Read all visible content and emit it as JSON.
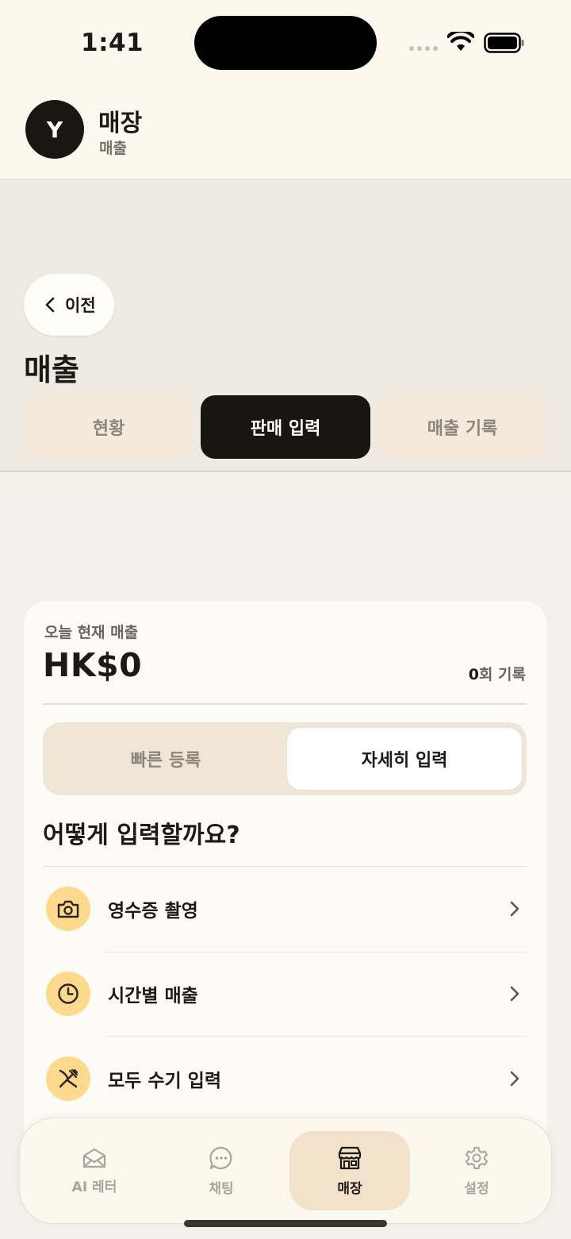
{
  "status_bar": {
    "time": "1:41"
  },
  "header": {
    "avatar_letter": "Y",
    "title": "매장",
    "subtitle": "매출"
  },
  "nav": {
    "back_label": "이전"
  },
  "page": {
    "title": "매출"
  },
  "segments": [
    {
      "label": "현황",
      "active": false
    },
    {
      "label": "판매 입력",
      "active": true
    },
    {
      "label": "매출 기록",
      "active": false
    }
  ],
  "summary": {
    "label": "오늘 현재 매출",
    "amount": "HK$0",
    "count_value": "0",
    "count_suffix": "회 기록"
  },
  "entry_mode": [
    {
      "label": "빠른 등록",
      "active": false
    },
    {
      "label": "자세히 입력",
      "active": true
    }
  ],
  "question": "어떻게 입력할까요?",
  "options": [
    {
      "label": "영수증 촬영",
      "icon": "camera-icon"
    },
    {
      "label": "시간별 매출",
      "icon": "clock-icon"
    },
    {
      "label": "모두 수기 입력",
      "icon": "utensils-icon"
    }
  ],
  "tabbar": [
    {
      "label": "AI 레터",
      "icon": "mail-icon",
      "active": false
    },
    {
      "label": "채팅",
      "icon": "chat-icon",
      "active": false
    },
    {
      "label": "매장",
      "icon": "store-icon",
      "active": true
    },
    {
      "label": "설정",
      "icon": "gear-icon",
      "active": false
    }
  ],
  "colors": {
    "accent_dark": "#191612",
    "icon_bg": "#fcd98d",
    "active_tab_bg": "#f3e2cb",
    "page_bg": "#f5f0e9"
  }
}
